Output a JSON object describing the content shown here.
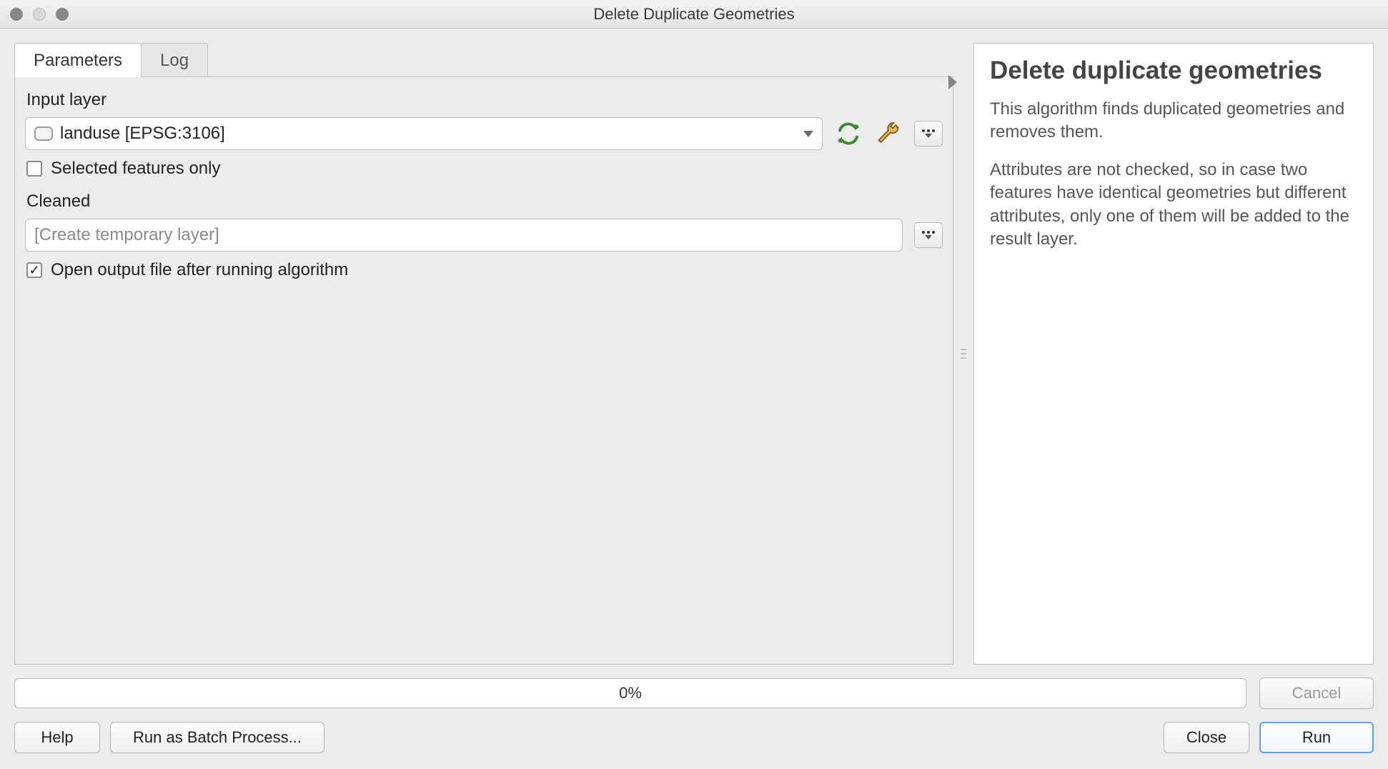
{
  "window": {
    "title": "Delete Duplicate Geometries"
  },
  "tabs": {
    "parameters": "Parameters",
    "log": "Log"
  },
  "params": {
    "input_layer_label": "Input layer",
    "input_layer_value": "landuse [EPSG:3106]",
    "selected_only_label": "Selected features only",
    "selected_only_checked": false,
    "cleaned_label": "Cleaned",
    "cleaned_placeholder": "[Create temporary layer]",
    "open_output_label": "Open output file after running algorithm",
    "open_output_checked": true
  },
  "help": {
    "title": "Delete duplicate geometries",
    "p1": "This algorithm finds duplicated geometries and removes them.",
    "p2": "Attributes are not checked, so in case two features have identical geometries but different attributes, only one of them will be added to the result layer."
  },
  "progress": {
    "text": "0%"
  },
  "buttons": {
    "cancel": "Cancel",
    "help": "Help",
    "batch": "Run as Batch Process...",
    "close": "Close",
    "run": "Run"
  }
}
